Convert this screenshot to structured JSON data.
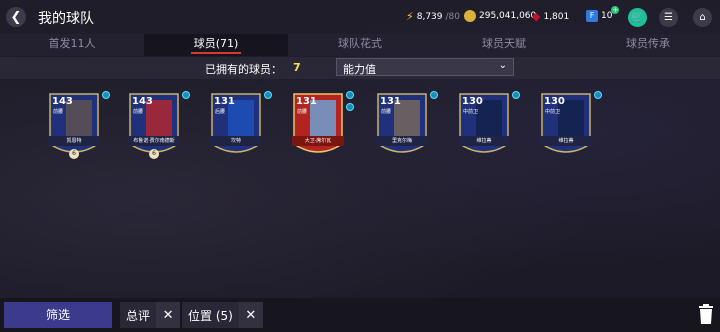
{
  "header": {
    "back_icon": "chevron-left-icon",
    "title": "我的球队",
    "currencies": [
      {
        "icon": "lightning-icon",
        "value": "8,739",
        "max": "/80",
        "color": "#f4c430"
      },
      {
        "icon": "coin-icon",
        "value": "295,041,060",
        "color": "#d9b23a"
      },
      {
        "icon": "gem-icon",
        "value": "1,801",
        "color": "#c8102e"
      },
      {
        "icon": "fifa-points-icon",
        "value": "10",
        "color": "#2c7be5"
      }
    ],
    "buttons": [
      "shop-cart-icon",
      "menu-icon",
      "home-icon"
    ]
  },
  "tabs": [
    {
      "label": "首发11人",
      "active": false
    },
    {
      "label": "球员(71)",
      "active": true
    },
    {
      "label": "球队花式",
      "active": false
    },
    {
      "label": "球员天赋",
      "active": false
    },
    {
      "label": "球员传承",
      "active": false
    }
  ],
  "filter": {
    "owned_label": "已拥有的球员：",
    "owned_count": "7",
    "sort_value": "能力值"
  },
  "players": [
    {
      "rating": "143",
      "pos": "前腰",
      "name": "凯恩特",
      "card": "toty",
      "upgrade": "6"
    },
    {
      "rating": "143",
      "pos": "前腰",
      "name": "布鲁诺·费尔南德斯",
      "card": "toty",
      "upgrade": "6"
    },
    {
      "rating": "131",
      "pos": "后腰",
      "name": "坎特",
      "card": "toty"
    },
    {
      "rating": "131",
      "pos": "前腰",
      "name": "大卫·席尔瓦",
      "card": "red"
    },
    {
      "rating": "131",
      "pos": "前腰",
      "name": "里克尔梅",
      "card": "toty"
    },
    {
      "rating": "130",
      "pos": "中前卫",
      "name": "维拉蒂",
      "card": "toty"
    },
    {
      "rating": "130",
      "pos": "中前卫",
      "name": "维拉蒂",
      "card": "toty"
    }
  ],
  "bottom": {
    "filter_label": "筛选",
    "chips": [
      {
        "label": "总评"
      },
      {
        "label": "位置 (5)"
      }
    ],
    "trash_icon": "trash-icon"
  }
}
